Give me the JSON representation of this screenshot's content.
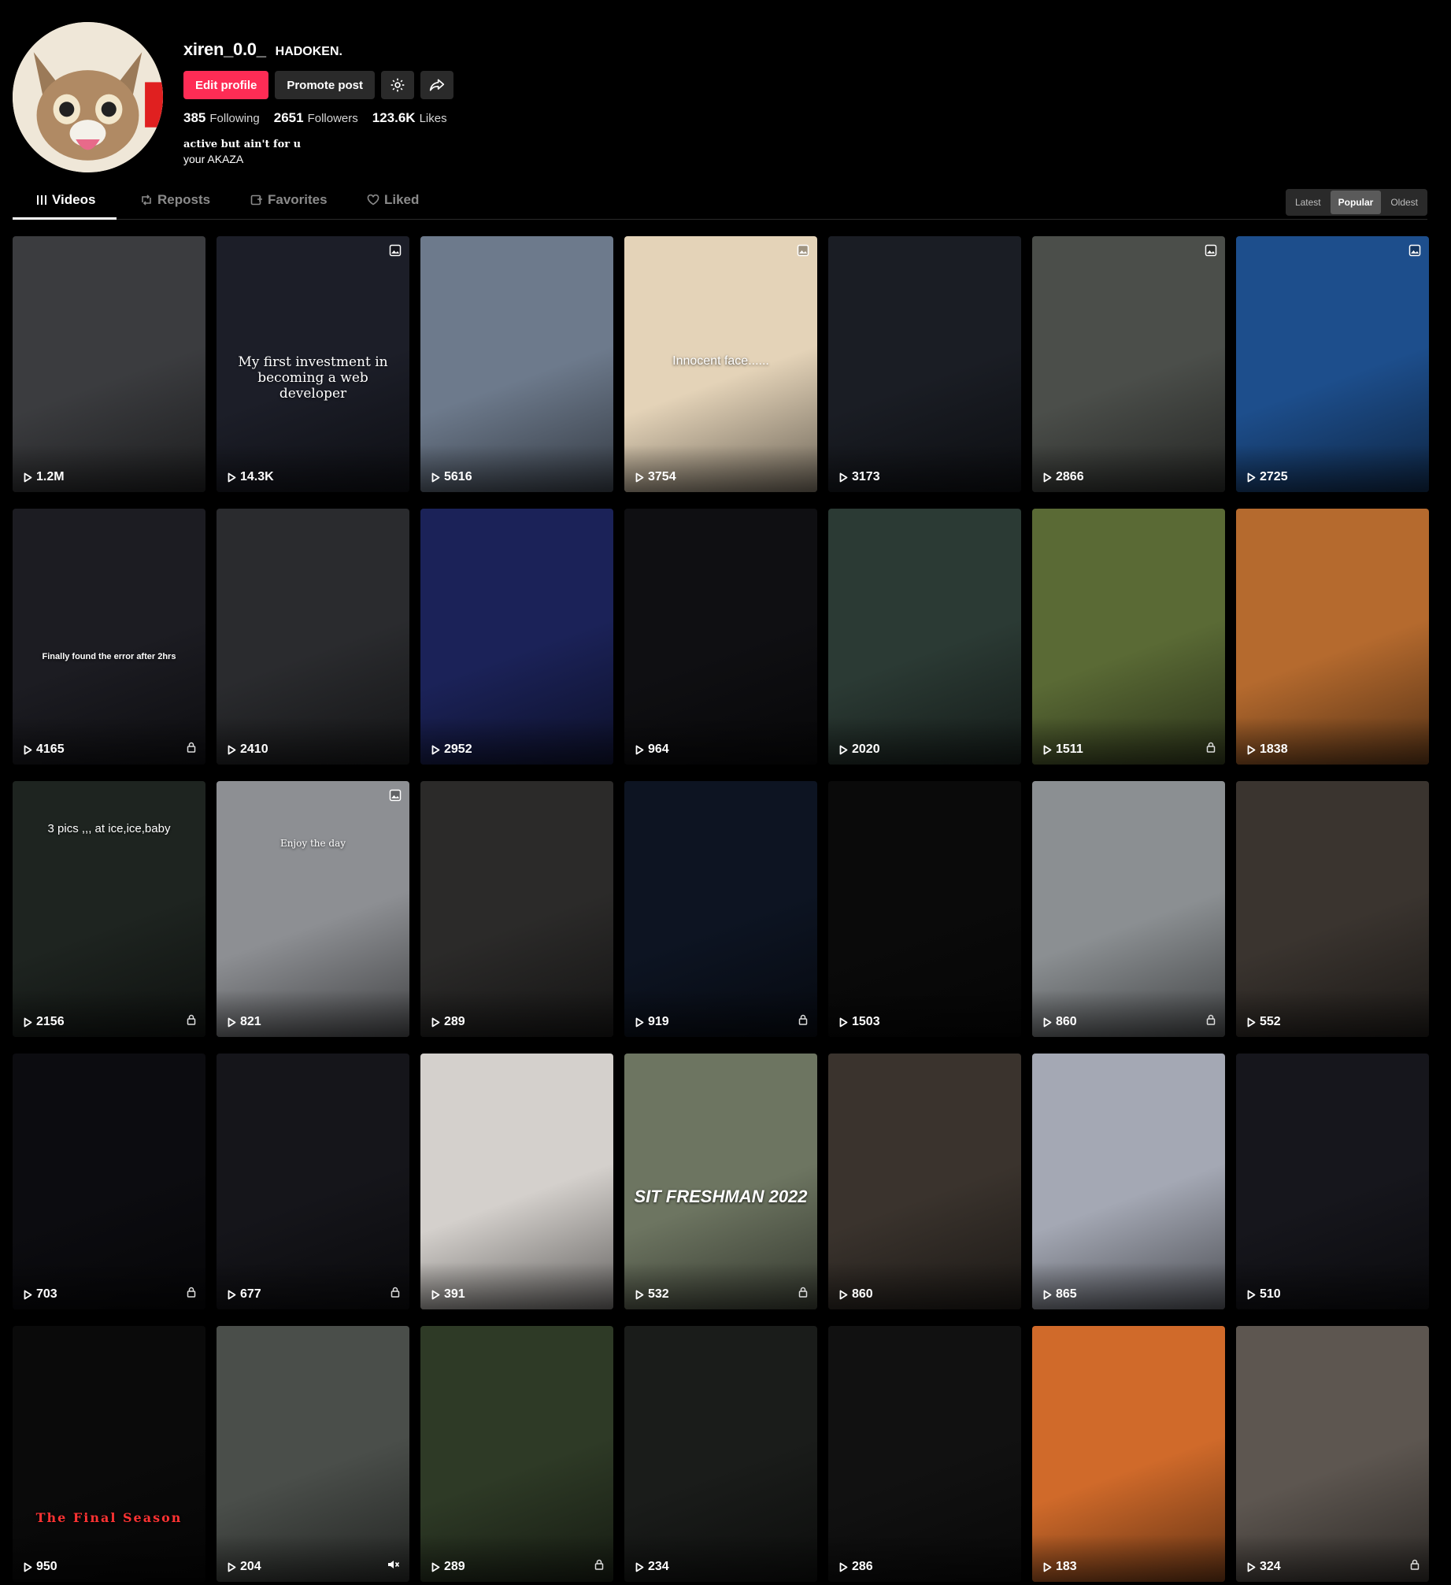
{
  "profile": {
    "username": "xiren_0.0_",
    "nickname": "HADOKEN.",
    "edit_label": "Edit profile",
    "promote_label": "Promote post",
    "following_count": "385",
    "following_label": "Following",
    "followers_count": "2651",
    "followers_label": "Followers",
    "likes_count": "123.6K",
    "likes_label": "Likes",
    "bio_line1": "active but ain't for u",
    "bio_line2": "your AKAZA",
    "accent_color": "#fe2c55"
  },
  "tabs": [
    {
      "label": "Videos",
      "icon": "grid-icon"
    },
    {
      "label": "Reposts",
      "icon": "repost-icon"
    },
    {
      "label": "Favorites",
      "icon": "bookmark-icon"
    },
    {
      "label": "Liked",
      "icon": "heart-icon"
    }
  ],
  "sort": [
    "Latest",
    "Popular",
    "Oldest"
  ],
  "videos": [
    {
      "views": "1.2M",
      "bg": "#3b3c3f",
      "caption": ""
    },
    {
      "views": "14.3K",
      "bg": "#1c1e28",
      "caption": "My first investment in becoming a web developer",
      "photo": true
    },
    {
      "views": "5616",
      "bg": "#6d7a8c",
      "caption": ""
    },
    {
      "views": "3754",
      "bg": "#e4d3b8",
      "caption": "Innocent face......",
      "photo": true
    },
    {
      "views": "3173",
      "bg": "#1a1d24",
      "caption": ""
    },
    {
      "views": "2866",
      "bg": "#4b4e4a",
      "caption": "",
      "photo": true
    },
    {
      "views": "2725",
      "bg": "#1d4e8c",
      "caption": "",
      "photo": true
    },
    {
      "views": "4165",
      "bg": "#1c1c22",
      "caption": "Finally found the error after 2hrs",
      "locked": true
    },
    {
      "views": "2410",
      "bg": "#2a2b2e",
      "caption": ""
    },
    {
      "views": "2952",
      "bg": "#1b2258",
      "caption": ""
    },
    {
      "views": "964",
      "bg": "#0f0f12",
      "caption": ""
    },
    {
      "views": "2020",
      "bg": "#2b3a34",
      "caption": ""
    },
    {
      "views": "1511",
      "bg": "#5a6a35",
      "caption": "",
      "locked": true
    },
    {
      "views": "1838",
      "bg": "#b56a2e",
      "caption": ""
    },
    {
      "views": "2156",
      "bg": "#1e2420",
      "caption": "3 pics ,,, at ice,ice,baby",
      "locked": true
    },
    {
      "views": "821",
      "bg": "#8d8f93",
      "caption": "Enjoy the day",
      "photo": true
    },
    {
      "views": "289",
      "bg": "#2b2a29",
      "caption": ""
    },
    {
      "views": "919",
      "bg": "#0d1422",
      "caption": "",
      "locked": true
    },
    {
      "views": "1503",
      "bg": "#0a0a0a",
      "caption": ""
    },
    {
      "views": "860",
      "bg": "#8b8f92",
      "caption": "",
      "locked": true
    },
    {
      "views": "552",
      "bg": "#3a342f",
      "caption": ""
    },
    {
      "views": "703",
      "bg": "#0c0c10",
      "caption": "",
      "locked": true
    },
    {
      "views": "677",
      "bg": "#15151a",
      "caption": "",
      "locked": true
    },
    {
      "views": "391",
      "bg": "#d4d0cc",
      "caption": ""
    },
    {
      "views": "532",
      "bg": "#6d7561",
      "caption": "SIT FRESHMAN 2022",
      "locked": true
    },
    {
      "views": "860",
      "bg": "#3a332d",
      "caption": ""
    },
    {
      "views": "865",
      "bg": "#a4a8b4",
      "caption": ""
    },
    {
      "views": "510",
      "bg": "#16161c",
      "caption": ""
    },
    {
      "views": "950",
      "bg": "#0a0a0a",
      "caption": "The Final Season"
    },
    {
      "views": "204",
      "bg": "#4a4e4a",
      "caption": "",
      "muted": true
    },
    {
      "views": "289",
      "bg": "#2e3a26",
      "caption": "",
      "locked": true
    },
    {
      "views": "234",
      "bg": "#1a1c1a",
      "caption": ""
    },
    {
      "views": "286",
      "bg": "#111",
      "caption": ""
    },
    {
      "views": "183",
      "bg": "#d06a2a",
      "caption": ""
    },
    {
      "views": "324",
      "bg": "#5d5650",
      "caption": "",
      "locked": true
    }
  ]
}
